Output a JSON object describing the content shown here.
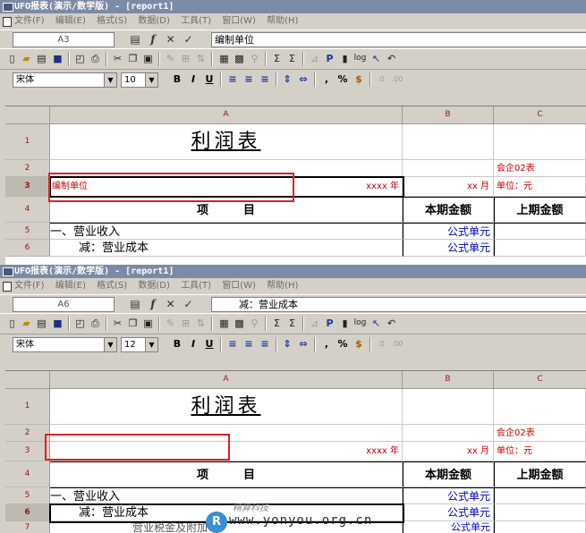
{
  "window": {
    "title": "UFO报表(演示/数学版) - [report1]",
    "menu": [
      "文件(F)",
      "编辑(E)",
      "格式(S)",
      "数据(D)",
      "工具(T)",
      "窗口(W)",
      "帮助(H)"
    ]
  },
  "toolbar_icons": [
    "new-icon",
    "open-icon",
    "copy-doc-icon",
    "save-icon",
    "print-preview-icon",
    "print-icon",
    "cut-icon",
    "copy-icon",
    "paste-icon",
    "format-painter-icon",
    "insert-icon",
    "sort-icon",
    "table-icon",
    "chart-icon",
    "find-icon",
    "sum-icon",
    "sum-row-icon",
    "filter-icon",
    "p-icon",
    "doc-icon",
    "log-icon",
    "help-icon",
    "undo-icon"
  ],
  "format_buttons": {
    "bold": "B",
    "italic": "I",
    "underline": "U",
    "percent": "%",
    "currency": "$",
    "comma": ","
  },
  "columns": [
    "A",
    "B",
    "C"
  ],
  "report": {
    "title": "利润表",
    "form_code": "会企02表",
    "unit_label": "单位：元",
    "year_text": "xxxx 年",
    "month_text": "xx 月",
    "col_item": "项　　　目",
    "col_current": "本期金额",
    "col_previous": "上期金额",
    "row5_item": "一、营业收入",
    "row6_item": "减：营业成本",
    "formula_cell": "公式单元",
    "row7_partial": "营业税金及附加"
  },
  "panel_top": {
    "cell_ref": "A3",
    "formula": "编制单位",
    "font": "宋体",
    "font_size": "10",
    "row3_label": "编制单位",
    "row_numbers": [
      "1",
      "2",
      "3",
      "4",
      "5",
      "6"
    ]
  },
  "panel_bottom": {
    "cell_ref": "A6",
    "formula": "减：营业成本",
    "font": "宋体",
    "font_size": "12",
    "row3_label": "",
    "row_numbers": [
      "1",
      "2",
      "3",
      "4",
      "5",
      "6",
      "7"
    ]
  },
  "watermark": {
    "text": "www.yonyou.org.cn",
    "sub": "精算科技"
  }
}
